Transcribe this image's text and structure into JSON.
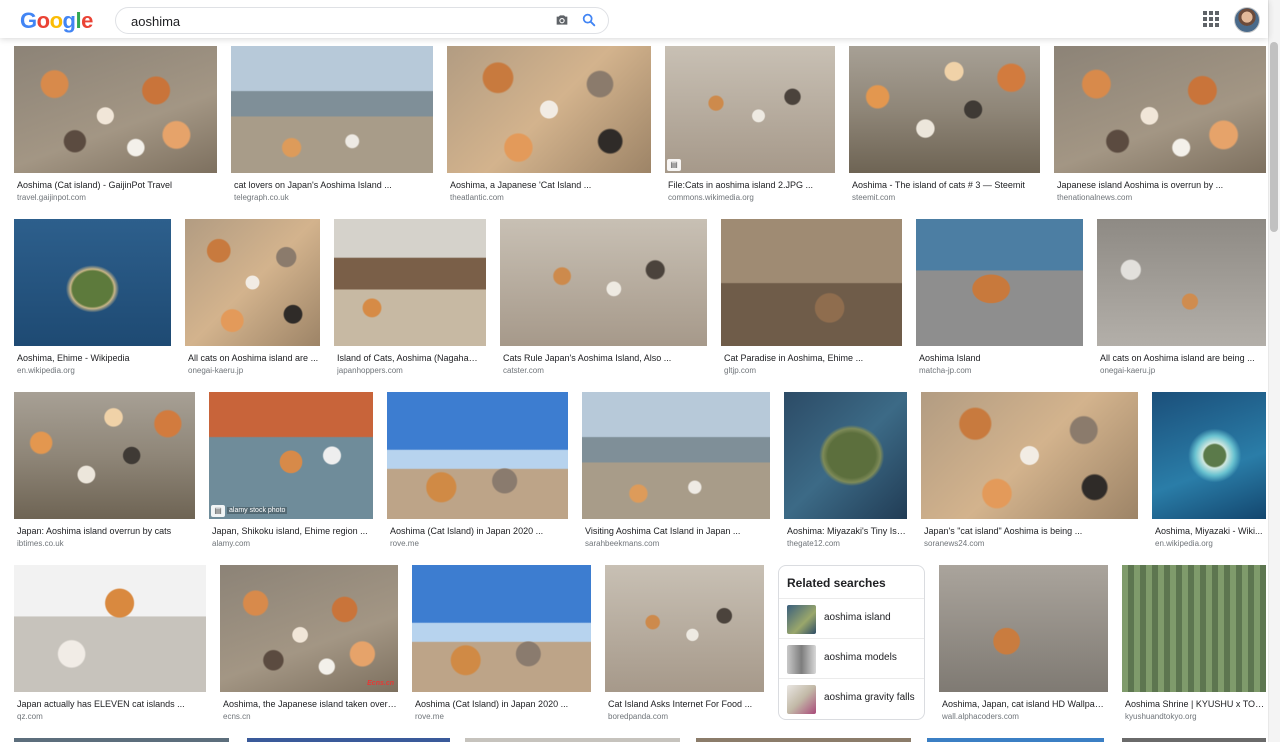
{
  "header": {
    "logo_letters": [
      "G",
      "o",
      "o",
      "g",
      "l",
      "e"
    ],
    "search_value": "aoshima",
    "icons": [
      "camera-icon",
      "search-icon",
      "apps-grid-icon",
      "account-avatar"
    ]
  },
  "results": [
    {
      "title": "Aoshima (Cat island) - GaijinPot Travel",
      "source": "travel.gaijinpot.com"
    },
    {
      "title": "cat lovers on Japan's Aoshima Island ...",
      "source": "telegraph.co.uk"
    },
    {
      "title": "Aoshima, a Japanese 'Cat Island ...",
      "source": "theatlantic.com"
    },
    {
      "title": "File:Cats in aoshima island 2.JPG ...",
      "source": "commons.wikimedia.org"
    },
    {
      "title": "Aoshima - The island of cats # 3 — Steemit",
      "source": "steemit.com"
    },
    {
      "title": "Japanese island Aoshima is overrun by ...",
      "source": "thenationalnews.com"
    },
    {
      "title": "Aoshima, Ehime - Wikipedia",
      "source": "en.wikipedia.org"
    },
    {
      "title": "All cats on Aoshima island are ...",
      "source": "onegai-kaeru.jp"
    },
    {
      "title": "Island of Cats, Aoshima (Nagahama...",
      "source": "japanhoppers.com"
    },
    {
      "title": "Cats Rule Japan's Aoshima Island, Also ...",
      "source": "catster.com"
    },
    {
      "title": "Cat Paradise in Aoshima, Ehime ...",
      "source": "gltjp.com"
    },
    {
      "title": "Aoshima Island",
      "source": "matcha-jp.com"
    },
    {
      "title": "All cats on Aoshima island are being ...",
      "source": "onegai-kaeru.jp"
    },
    {
      "title": "Japan: Aoshima island overrun by cats",
      "source": "ibtimes.co.uk"
    },
    {
      "title": "Japan, Shikoku island, Ehime region ...",
      "source": "alamy.com",
      "watermark": "alamy stock photo"
    },
    {
      "title": "Aoshima (Cat Island) in Japan 2020 ...",
      "source": "rove.me"
    },
    {
      "title": "Visiting Aoshima Cat Island in Japan ...",
      "source": "sarahbeekmans.com"
    },
    {
      "title": "Aoshima: Miyazaki's Tiny Isl...",
      "source": "thegate12.com"
    },
    {
      "title": "Japan's \"cat island\" Aoshima is being ...",
      "source": "soranews24.com"
    },
    {
      "title": "Aoshima, Miyazaki - Wiki...",
      "source": "en.wikipedia.org"
    },
    {
      "title": "Japan actually has ELEVEN cat islands ...",
      "source": "qz.com"
    },
    {
      "title": "Aoshima, the Japanese island taken over ...",
      "source": "ecns.cn",
      "watermark": "Ecns.cn"
    },
    {
      "title": "Aoshima (Cat Island) in Japan 2020 ...",
      "source": "rove.me"
    },
    {
      "title": "Cat Island Asks Internet For Food ...",
      "source": "boredpanda.com"
    },
    {
      "title": "Aoshima, Japan, cat island HD Wallpap...",
      "source": "wall.alphacoders.com"
    },
    {
      "title": "Aoshima Shrine | KYUSHU x TOK...",
      "source": "kyushuandtokyo.org"
    }
  ],
  "related": {
    "title": "Related searches",
    "items": [
      "aoshima island",
      "aoshima models",
      "aoshima gravity falls"
    ]
  }
}
